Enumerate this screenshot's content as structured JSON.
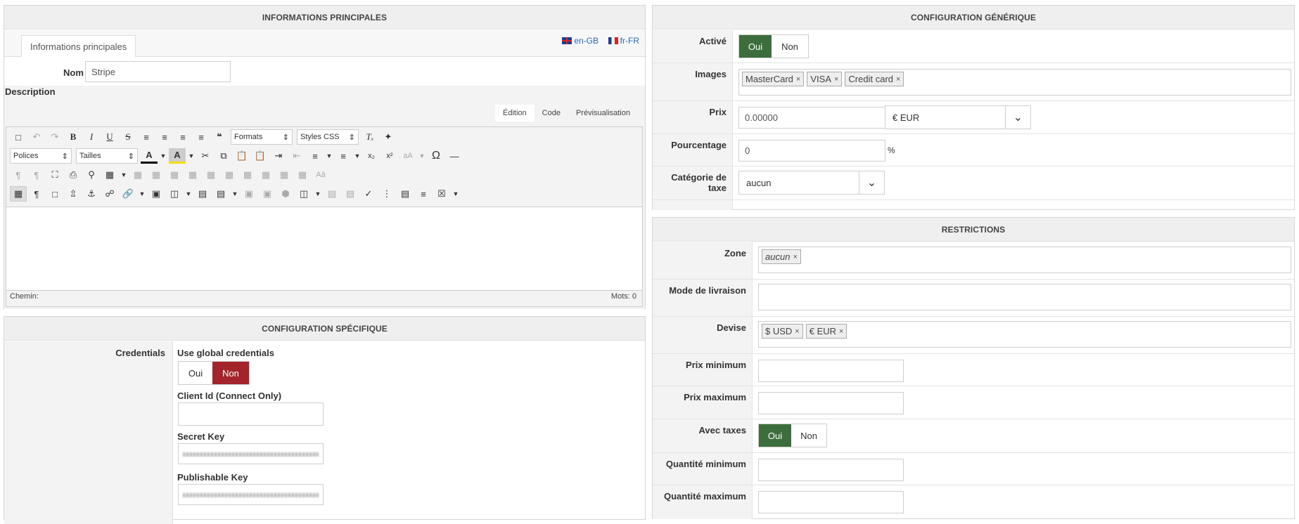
{
  "main": {
    "title": "INFORMATIONS PRINCIPALES",
    "tab": "Informations principales",
    "lang_en": "en-GB",
    "lang_fr": "fr-FR",
    "name_label": "Nom",
    "name_value": "Stripe",
    "description_label": "Description",
    "editor_tabs": [
      "Édition",
      "Code",
      "Prévisualisation"
    ],
    "formats": "Formats",
    "styles_css": "Styles CSS",
    "polices": "Polices",
    "tailles": "Tailles",
    "status_path": "Chemin:",
    "word_count": "Mots: 0"
  },
  "specific": {
    "title": "CONFIGURATION SPÉCIFIQUE",
    "credentials_label": "Credentials",
    "use_global_label": "Use global credentials",
    "yes": "Oui",
    "no": "Non",
    "client_id_label": "Client Id (Connect Only)",
    "secret_key_label": "Secret Key",
    "publishable_key_label": "Publishable Key"
  },
  "generic": {
    "title": "CONFIGURATION GÉNÉRIQUE",
    "active_label": "Activé",
    "yes": "Oui",
    "no": "Non",
    "images_label": "Images",
    "images": [
      "MasterCard",
      "VISA",
      "Credit card"
    ],
    "price_label": "Prix",
    "price_value": "0.00000",
    "currency_value": "€ EUR",
    "percent_label": "Pourcentage",
    "percent_value": "0",
    "percent_unit": "%",
    "tax_cat_label": "Catégorie de taxe",
    "tax_cat_value": "aucun"
  },
  "restrictions": {
    "title": "RESTRICTIONS",
    "zone_label": "Zone",
    "zone_tag": "aucun",
    "shipping_label": "Mode de livraison",
    "currency_label": "Devise",
    "currencies": [
      "$ USD",
      "€ EUR"
    ],
    "min_price_label": "Prix minimum",
    "max_price_label": "Prix maximum",
    "with_taxes_label": "Avec taxes",
    "yes": "Oui",
    "no": "Non",
    "min_qty_label": "Quantité minimum",
    "max_qty_label": "Quantité maximum"
  },
  "colors": {
    "toggle_green": "#3c6e3d",
    "toggle_red": "#a3242a",
    "link_blue": "#2a6ab0"
  }
}
